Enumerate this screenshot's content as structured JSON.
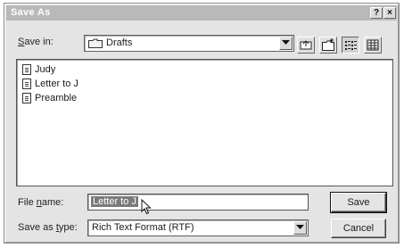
{
  "window": {
    "title": "Save As",
    "help_glyph": "?",
    "close_glyph": "×"
  },
  "save_in": {
    "label_pre": "",
    "label_accel": "S",
    "label_post": "ave in:",
    "value": "Drafts"
  },
  "toolbar": {
    "icons": [
      "up-one-level-icon",
      "new-folder-icon",
      "list-view-icon",
      "details-view-icon"
    ]
  },
  "files": [
    {
      "name": "Judy"
    },
    {
      "name": "Letter to J"
    },
    {
      "name": "Preamble"
    }
  ],
  "file_name": {
    "label_pre": "File ",
    "label_accel": "n",
    "label_post": "ame:",
    "value": "Letter to J"
  },
  "save_as_type": {
    "label_pre": "Save as ",
    "label_accel": "t",
    "label_post": "ype:",
    "value": "Rich Text Format (RTF)"
  },
  "buttons": {
    "save": "Save",
    "cancel": "Cancel"
  },
  "colors": {
    "titlebar": "#b9b9b9",
    "dialog_bg": "#e4e4e4",
    "selection": "#7a7a7a"
  }
}
